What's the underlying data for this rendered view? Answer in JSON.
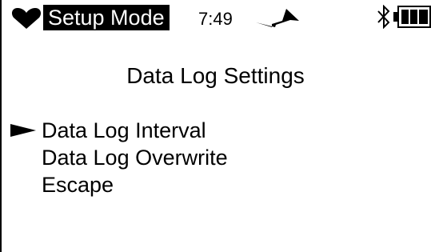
{
  "status_bar": {
    "heart_icon": "heart-icon",
    "mode_label": "Setup Mode",
    "time": "7:49",
    "signal_icon": "signal-icon",
    "bluetooth_icon": "bluetooth-icon",
    "battery_icon": "battery-icon",
    "battery_level": 1.0
  },
  "page": {
    "title": "Data Log Settings"
  },
  "menu": {
    "selected_index": 0,
    "items": [
      {
        "label": "Data Log Interval"
      },
      {
        "label": "Data Log Overwrite"
      },
      {
        "label": "Escape"
      }
    ]
  },
  "colors": {
    "foreground": "#000000",
    "background": "#ffffff"
  }
}
